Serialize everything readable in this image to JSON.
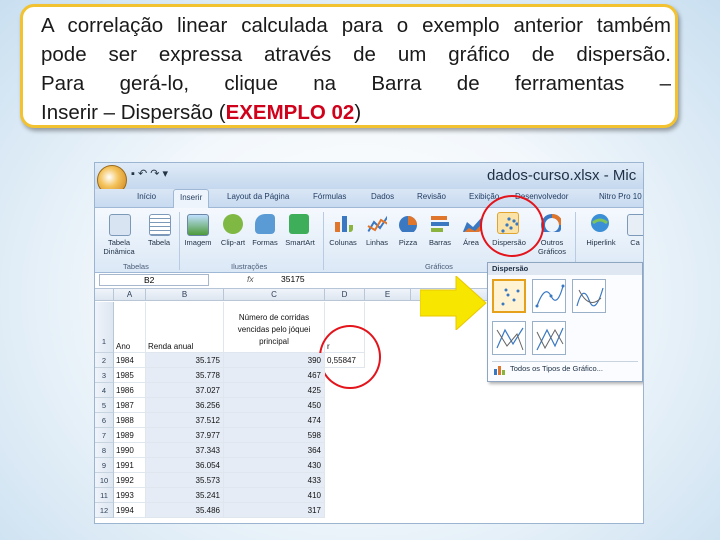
{
  "callout": {
    "line1": "A correlação linear calculada para o exemplo anterior também",
    "line2": "pode ser expressa através de um gráfico de dispersão.",
    "line3": "Para gerá-lo, clique na Barra de ferramentas –",
    "line4_prefix": "Inserir – Dispersão (",
    "line4_highlight": "EXEMPLO 02",
    "line4_suffix": ")"
  },
  "window": {
    "title": "dados-curso.xlsx - Mic"
  },
  "tabs": [
    "Início",
    "Inserir",
    "Layout da Página",
    "Fórmulas",
    "Dados",
    "Revisão",
    "Exibição",
    "Desenvolvedor",
    "Nitro Pro 10"
  ],
  "active_tab": "Inserir",
  "ribbon": {
    "buttons": [
      {
        "label": "Tabela Dinâmica",
        "icon": "pivot-table-icon"
      },
      {
        "label": "Tabela",
        "icon": "table-icon"
      },
      {
        "label": "Imagem",
        "icon": "image-icon"
      },
      {
        "label": "Clip-art",
        "icon": "clipart-icon"
      },
      {
        "label": "Formas",
        "icon": "shapes-icon"
      },
      {
        "label": "SmartArt",
        "icon": "smartart-icon"
      },
      {
        "label": "Colunas",
        "icon": "column-chart-icon"
      },
      {
        "label": "Linhas",
        "icon": "line-chart-icon"
      },
      {
        "label": "Pizza",
        "icon": "pie-chart-icon"
      },
      {
        "label": "Barras",
        "icon": "bar-chart-icon"
      },
      {
        "label": "Área",
        "icon": "area-chart-icon"
      },
      {
        "label": "Dispersão",
        "icon": "scatter-chart-icon"
      },
      {
        "label": "Outros Gráficos",
        "icon": "other-charts-icon"
      },
      {
        "label": "Hiperlink",
        "icon": "hyperlink-icon"
      },
      {
        "label": "Ca",
        "icon": "textbox-icon"
      }
    ],
    "groups": [
      "Tabelas",
      "Ilustrações",
      "Gráficos"
    ]
  },
  "formula_bar": {
    "cell": "B2",
    "fx": "fx",
    "value": "35175"
  },
  "columns": [
    "A",
    "B",
    "C",
    "D",
    "E",
    "F"
  ],
  "rows": [
    "1",
    "2",
    "3",
    "4",
    "5",
    "6",
    "7",
    "8",
    "9",
    "10",
    "11",
    "12"
  ],
  "table": {
    "header_a": "Ano",
    "header_b": "Renda anual",
    "header_c": "Número de corridas vencidas pelo jóquei principal",
    "data": [
      [
        "1984",
        "35.175",
        "390"
      ],
      [
        "1985",
        "35.778",
        "467"
      ],
      [
        "1986",
        "37.027",
        "425"
      ],
      [
        "1987",
        "36.256",
        "450"
      ],
      [
        "1988",
        "37.512",
        "474"
      ],
      [
        "1989",
        "37.977",
        "598"
      ],
      [
        "1990",
        "37.343",
        "364"
      ],
      [
        "1991",
        "36.054",
        "430"
      ],
      [
        "1992",
        "35.573",
        "433"
      ],
      [
        "1993",
        "35.241",
        "410"
      ],
      [
        "1994",
        "35.486",
        "317"
      ]
    ],
    "correlation": "0,55847",
    "d_header": "r"
  },
  "dropdown": {
    "title": "Dispersão",
    "all_types": "Todos os Tipos de Gráfico..."
  },
  "colors": {
    "highlight_ring": "#e3141b",
    "arrow": "#f7e600",
    "callout_border": "#f2c230",
    "emphasis": "#d0021b"
  }
}
